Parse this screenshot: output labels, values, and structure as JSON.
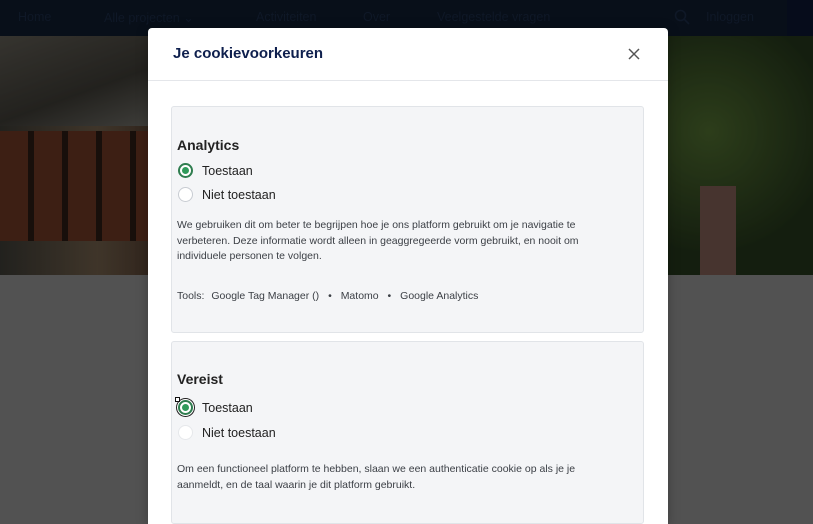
{
  "nav": {
    "items": [
      "Home",
      "Alle projecten ⌄",
      "Activiteiten",
      "Over",
      "Veelgestelde vragen"
    ],
    "login": "Inloggen"
  },
  "modal": {
    "title": "Je cookievoorkeuren",
    "sections": [
      {
        "title": "Analytics",
        "options": [
          {
            "label": "Toestaan",
            "selected": true
          },
          {
            "label": "Niet toestaan",
            "selected": false
          }
        ],
        "description": "We gebruiken dit om beter te begrijpen hoe je ons platform gebruikt om je navigatie te verbeteren. Deze informatie wordt alleen in geaggregeerde vorm gebruikt, en nooit om individuele personen te volgen.",
        "tools_label": "Tools:",
        "tools": [
          "Google Tag Manager ()",
          "Matomo",
          "Google Analytics"
        ]
      },
      {
        "title": "Vereist",
        "options": [
          {
            "label": "Toestaan",
            "selected": true
          },
          {
            "label": "Niet toestaan",
            "selected": false
          }
        ],
        "description": "Om een functioneel platform te hebben, slaan we een authenticatie cookie op als je je aanmeldt, en de taal waarin je dit platform gebruikt."
      }
    ]
  },
  "colors": {
    "accent_green": "#2f9a5a",
    "title_navy": "#0e1f4d"
  }
}
